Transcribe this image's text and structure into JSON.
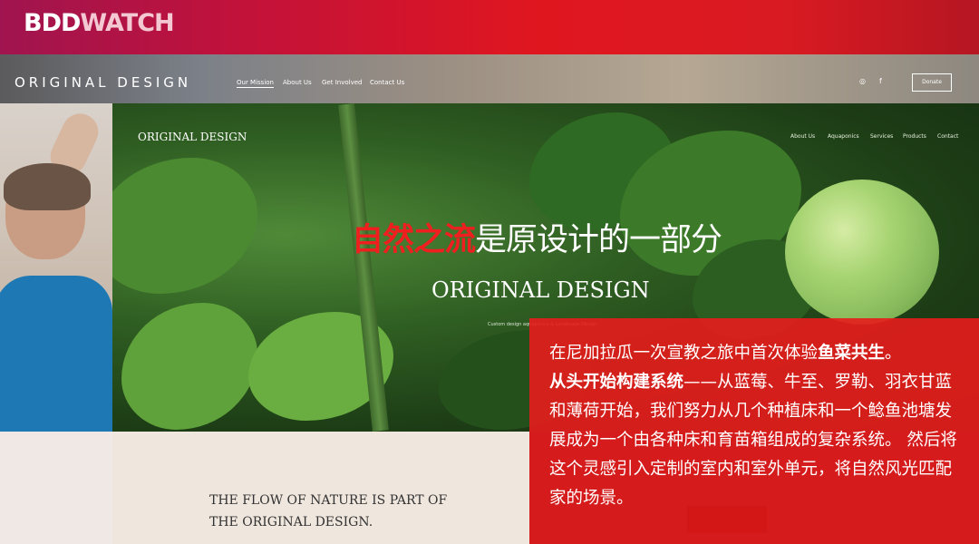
{
  "watermark": {
    "brand_part1": "BDD",
    "brand_part2": "WATCH"
  },
  "site_header": {
    "logo": "ORIGINAL DESIGN",
    "nav": [
      "Our Mission",
      "About Us",
      "Get Involved",
      "Contact Us"
    ],
    "social_icons": [
      "instagram-icon",
      "facebook-icon"
    ],
    "donate_label": "Donate"
  },
  "hero": {
    "site_logo": "ORIGINAL DESIGN",
    "nav": [
      "About Us",
      "Aquaponics",
      "Services",
      "Products",
      "Contact"
    ],
    "headline_highlight": "自然之流",
    "headline_rest": "是原设计的一部分",
    "title": "ORIGINAL DESIGN",
    "tiny_caption": "Custom design aquaponics & Landscape Design"
  },
  "lower_panel": {
    "line1": "THE FLOW OF NATURE IS PART OF",
    "line2": "THE ORIGINAL DESIGN."
  },
  "caption_box": {
    "p1": "在尼加拉瓜一次宣教之旅中首次体验",
    "p1_bold": "鱼菜共生",
    "p1_end": "。",
    "p2_bold": "从头开始构建系统",
    "p2": "——从蓝莓、牛至、罗勒、羽衣甘蓝和薄荷开始，我们努力从几个种植床和一个鲶鱼池塘发展成为一个由各种床和育苗箱组成的复杂系统。 然后将这个灵感引入定制的室内和室外单元，将自然风光匹配家的场景。"
  },
  "colors": {
    "accent_red": "#e81c1c",
    "brand_bar": "#d91a22",
    "cream": "#efe6de"
  }
}
